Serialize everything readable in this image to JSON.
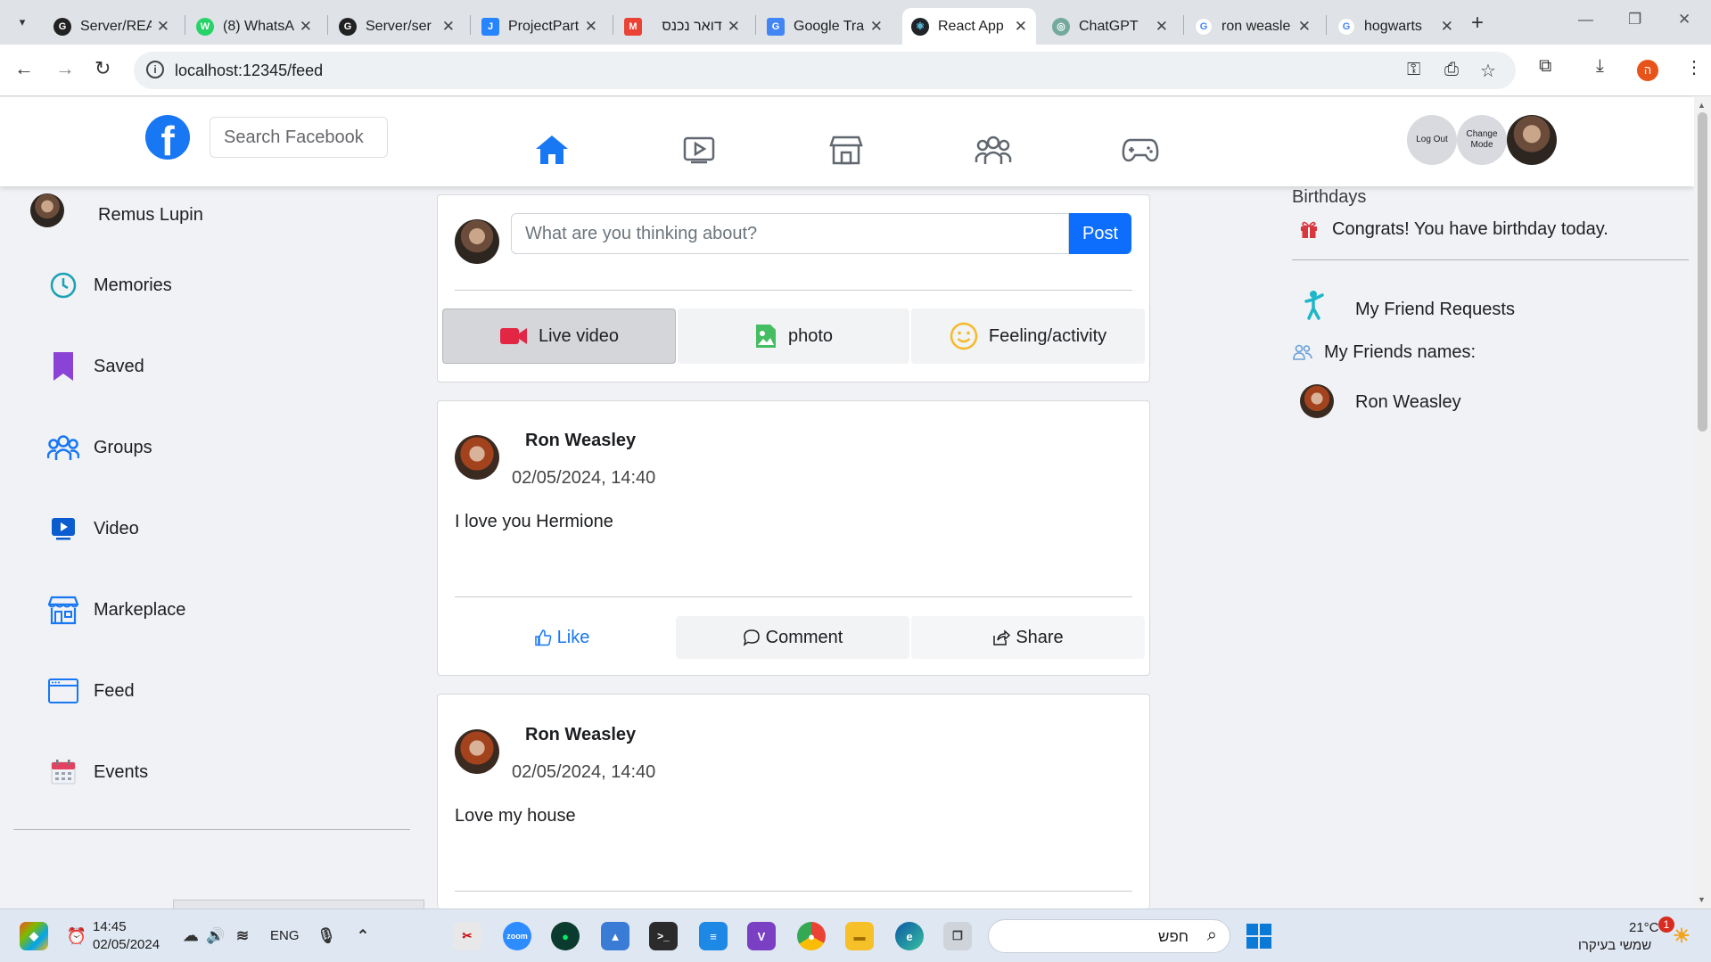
{
  "browser": {
    "tabs": [
      {
        "label": "Server/REA",
        "favicon": "github-icon"
      },
      {
        "label": "(8) WhatsA",
        "favicon": "whatsapp-icon"
      },
      {
        "label": "Server/ser",
        "favicon": "github-icon"
      },
      {
        "label": "ProjectPart",
        "favicon": "jira-icon"
      },
      {
        "label": "דואר נכנס",
        "favicon": "gmail-icon"
      },
      {
        "label": "Google Tra",
        "favicon": "google-translate-icon"
      },
      {
        "label": "React App",
        "favicon": "react-icon"
      },
      {
        "label": "ChatGPT",
        "favicon": "chatgpt-icon"
      },
      {
        "label": "ron weasle",
        "favicon": "google-icon"
      },
      {
        "label": "hogwarts",
        "favicon": "google-icon"
      }
    ],
    "active_tab": "React App",
    "url": "localhost:12345/feed",
    "profile_initial": "ה"
  },
  "header": {
    "search_placeholder": "Search Facebook",
    "nav_icons": [
      "home-icon",
      "watch-icon",
      "marketplace-icon",
      "groups-icon",
      "gaming-icon"
    ],
    "logout_label": "Log Out",
    "change_mode_label": "Change Mode"
  },
  "sidebar": {
    "user_name": "Remus Lupin",
    "items": [
      {
        "label": "Memories",
        "icon": "clock-icon"
      },
      {
        "label": "Saved",
        "icon": "bookmark-icon"
      },
      {
        "label": "Groups",
        "icon": "groups-icon"
      },
      {
        "label": "Video",
        "icon": "video-icon"
      },
      {
        "label": "Markeplace",
        "icon": "store-icon"
      },
      {
        "label": "Feed",
        "icon": "feed-icon"
      },
      {
        "label": "Events",
        "icon": "calendar-icon"
      }
    ]
  },
  "composer": {
    "placeholder": "What are you thinking about?",
    "post_label": "Post",
    "actions": [
      {
        "label": "Live video",
        "icon": "live-video-icon"
      },
      {
        "label": "photo",
        "icon": "photo-icon"
      },
      {
        "label": "Feeling/activity",
        "icon": "smiley-icon"
      }
    ]
  },
  "posts": [
    {
      "author": "Ron Weasley",
      "time": "02/05/2024, 14:40",
      "text": "I love you Hermione"
    },
    {
      "author": "Ron Weasley",
      "time": "02/05/2024, 14:40",
      "text": "Love my house"
    }
  ],
  "post_actions": {
    "like": "Like",
    "comment": "Comment",
    "share": "Share"
  },
  "right": {
    "birthdays_title": "Birthdays",
    "birthday_text": "Congrats! You have birthday today.",
    "friend_requests": "My Friend Requests",
    "friends_title": "My Friends names:",
    "friends": [
      "Ron Weasley"
    ]
  },
  "taskbar": {
    "time": "14:45",
    "date": "02/05/2024",
    "lang": "ENG",
    "search_text": "חפש",
    "weather_temp": "21°C",
    "weather_desc": "שמשי בעיקרו",
    "notification_count": "1"
  },
  "colors": {
    "fb_blue": "#1877f2",
    "post_button": "#0d6efd",
    "like_blue": "#1877f2",
    "live_red": "#e42645",
    "photo_green": "#45bd62",
    "feeling_yellow": "#f7b928"
  }
}
